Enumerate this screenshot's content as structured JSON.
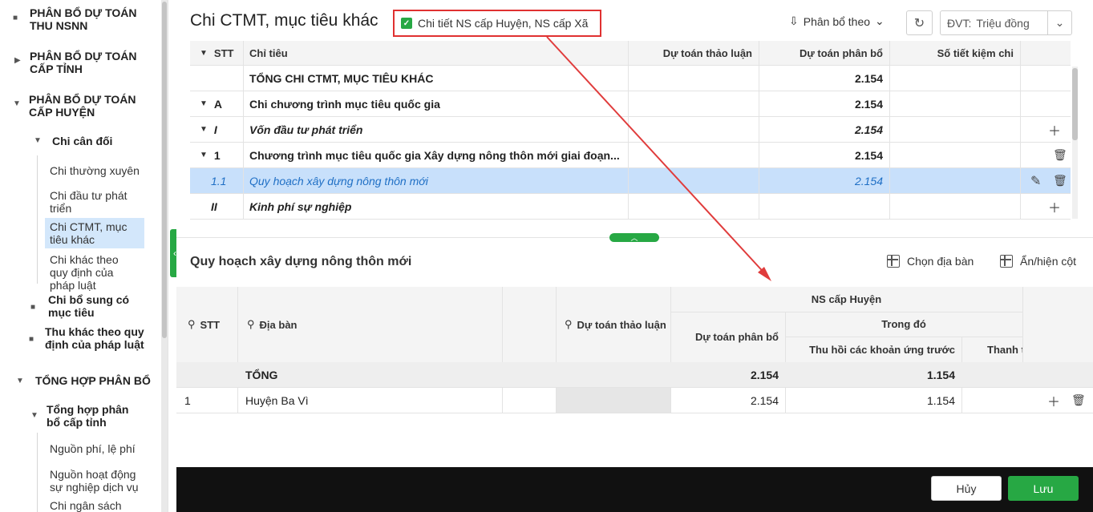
{
  "sidebar": {
    "sections": [
      {
        "label": "PHÂN BỔ DỰ TOÁN THU NSNN"
      },
      {
        "label": "PHÂN BỔ DỰ TOÁN CẤP TỈNH"
      },
      {
        "label": "PHÂN BỔ DỰ TOÁN CẤP HUYỆN"
      },
      {
        "label": "TỔNG HỢP PHÂN BỔ"
      }
    ],
    "chi_can_doi": "Chi cân đối",
    "leaves_huyen": [
      "Chi thường xuyên",
      "Chi đầu tư phát triển",
      "Chi CTMT, mục tiêu khác",
      "Chi khác theo quy định của pháp luật"
    ],
    "chi_bo_sung": "Chi bổ sung có mục tiêu",
    "thu_khac": "Thu khác theo quy định của pháp luật",
    "tong_hop_tinh": "Tổng hợp phân bổ cấp tỉnh",
    "leaves_tong_hop": [
      "Nguồn phí, lệ phí",
      "Nguồn hoạt động sự nghiệp dịch vụ",
      "Chi ngân sách"
    ]
  },
  "header": {
    "title": "Chi CTMT, mục tiêu khác",
    "detail_checkbox_label": "Chi tiết NS cấp Huyện, NS cấp Xã",
    "phan_bo_theo": "Phân bổ theo",
    "dvt_label": "ĐVT:",
    "dvt_value": "Triệu đồng"
  },
  "top_table": {
    "headers": [
      "STT",
      "Chỉ tiêu",
      "Dự toán thảo luận",
      "Dự toán phân bổ",
      "Số tiết kiệm chi"
    ],
    "rows": [
      {
        "stt": "",
        "chi_tieu": "TỔNG CHI CTMT, MỤC TIÊU KHÁC",
        "phan_bo": "2.154"
      },
      {
        "stt": "A",
        "chi_tieu": "Chi chương trình mục tiêu quốc gia",
        "phan_bo": "2.154"
      },
      {
        "stt": "I",
        "chi_tieu": "Vốn đầu tư phát triển",
        "phan_bo": "2.154"
      },
      {
        "stt": "1",
        "chi_tieu": "Chương trình mục tiêu quốc gia Xây dựng nông thôn mới giai đoạn...",
        "phan_bo": "2.154"
      },
      {
        "stt": "1.1",
        "chi_tieu": "Quy hoạch xây dựng nông thôn mới",
        "phan_bo": "2.154"
      },
      {
        "stt": "II",
        "chi_tieu": "Kinh phí sự nghiệp",
        "phan_bo": ""
      }
    ]
  },
  "detail": {
    "title": "Quy hoạch xây dựng nông thôn mới",
    "chon_dia_ban": "Chọn địa bàn",
    "an_hien_cot": "Ẩn/hiện cột",
    "headers": {
      "stt": "STT",
      "dia_ban": "Địa bàn",
      "du_toan_thao_luan": "Dự toán thảo luận",
      "ns_cap_huyen": "NS cấp Huyện",
      "du_toan_phan_bo": "Dự toán phân bổ",
      "trong_do": "Trong đó",
      "thu_hoi": "Thu hồi các khoản ứng trước",
      "thanh_toan": "Thanh t"
    },
    "total": {
      "label": "TỔNG",
      "phan_bo": "2.154",
      "thu_hoi": "1.154"
    },
    "rows": [
      {
        "stt": "1",
        "dia_ban": "Huyện Ba Vì",
        "phan_bo": "2.154",
        "thu_hoi": "1.154"
      }
    ]
  },
  "footer": {
    "cancel": "Hủy",
    "save": "Lưu"
  }
}
